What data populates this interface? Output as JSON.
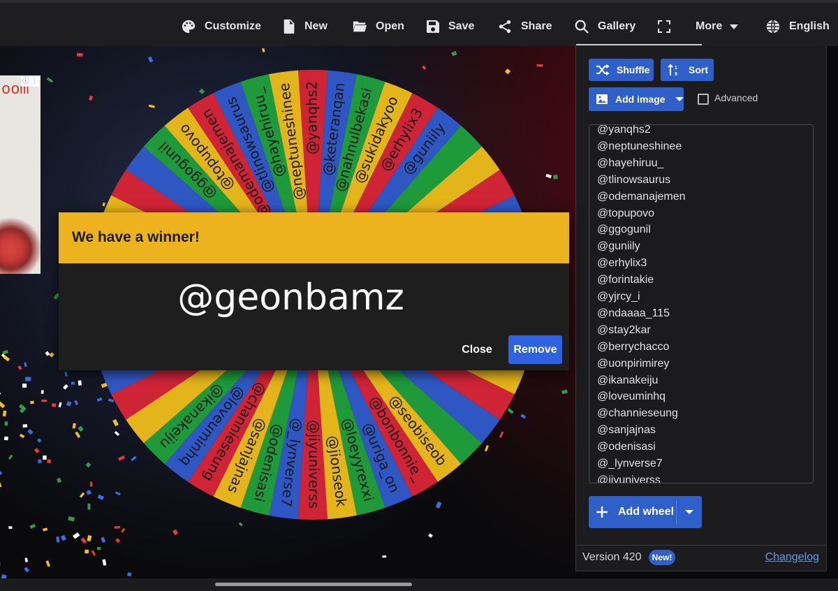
{
  "toolbar": {
    "customize": "Customize",
    "new": "New",
    "open": "Open",
    "save": "Save",
    "share": "Share",
    "gallery": "Gallery",
    "more": "More",
    "language": "English"
  },
  "ad": {
    "text": "oom",
    "info": "ⓘ ⋮"
  },
  "wheel": {
    "colors": [
      "#cf2436",
      "#2f57c4",
      "#1e9a3a",
      "#e4b51a"
    ],
    "top_labels": [
      "@ggogunil",
      "@topupovo",
      "@odemanajemen",
      "@tlinowsaurus",
      "@hayehiruu_",
      "@neptuneshinee",
      "@yanqhs2",
      "@keteranqan",
      "@nahnulbekasi",
      "@sukidakyoo",
      "@erhylix3",
      "@guniily"
    ],
    "bottom_labels": [
      "@ikanakeiju",
      "@loveuminhq",
      "@channieseung",
      "@sanjajnas",
      "@odenisasi",
      "@_lynverse7",
      "@jiyuniverss",
      "@jionseok",
      "@loeyyrexxi",
      "@uriga_on",
      "@bonbonnie_",
      "@seobiseob"
    ]
  },
  "panel": {
    "shuffle": "Shuffle",
    "sort": "Sort",
    "add_image": "Add image",
    "advanced": "Advanced",
    "entries": [
      "@yanqhs2",
      "@neptuneshinee",
      "@hayehiruu_",
      "@tlinowsaurus",
      "@odemanajemen",
      "@topupovo",
      "@ggogunil",
      "@guniily",
      "@erhylix3",
      "@forintakie",
      "@yjrcy_i",
      "@ndaaaa_115",
      "@stay2kar",
      "@berrychacco",
      "@uonpirimirey",
      "@ikanakeiju",
      "@loveuminhq",
      "@channieseung",
      "@sanjajnas",
      "@odenisasi",
      "@_lynverse7",
      "@jiyuniverss"
    ],
    "add_wheel": "Add wheel",
    "version": "Version 420",
    "new_badge": "New!",
    "changelog": "Changelog"
  },
  "dialog": {
    "title": "We have a winner!",
    "winner": "@geonbamz",
    "close": "Close",
    "remove": "Remove"
  },
  "accent": "#2f5fc9",
  "dialog_header_color": "#edb31e"
}
